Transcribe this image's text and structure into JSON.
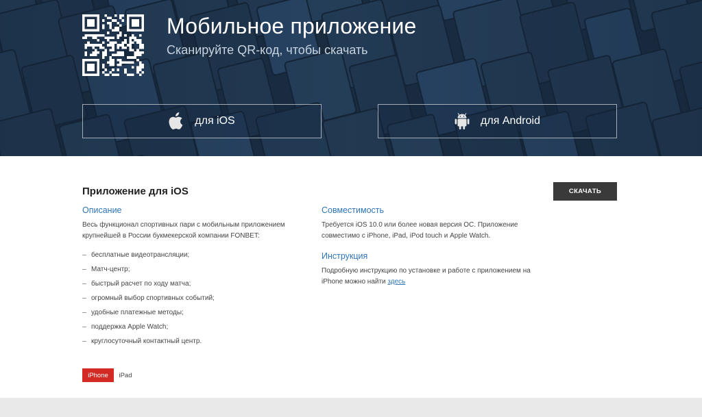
{
  "hero": {
    "title": "Мобильное приложение",
    "subtitle": "Сканируйте QR-код, чтобы скачать",
    "buttons": {
      "ios_label": "для iOS",
      "android_label": "для Android"
    }
  },
  "content": {
    "title": "Приложение для iOS",
    "download_label": "СКАЧАТЬ",
    "description": {
      "title": "Описание",
      "text": "Весь функционал спортивных пари с мобильным приложением крупнейшей в России букмекерской компании FONBET:",
      "features": [
        "бесплатные видеотрансляции;",
        "Матч-центр;",
        "быстрый расчет по ходу матча;",
        "огромный выбор спортивных событий;",
        "удобные платежные методы;",
        "поддержка Apple Watch;",
        "круглосуточный контактный центр."
      ]
    },
    "compatibility": {
      "title": "Совместимость",
      "text": "Требуется iOS 10.0 или более новая версия ОС. Приложение совместимо с iPhone, iPad, iPod touch и Apple Watch."
    },
    "instructions": {
      "title": "Инструкция",
      "text": "Подробную инструкцию по установке и работе с приложением на iPhone можно найти",
      "link": "здесь"
    },
    "device_tabs": [
      "iPhone",
      "iPad"
    ]
  },
  "colors": {
    "hero_bg": "#1e3146",
    "accent_blue": "#2f75b8",
    "tab_active": "#d32a24",
    "download_btn": "#3a3a3a"
  },
  "icons": {
    "qr": "qr-code-icon",
    "ios": "apple-icon",
    "android": "android-icon"
  }
}
